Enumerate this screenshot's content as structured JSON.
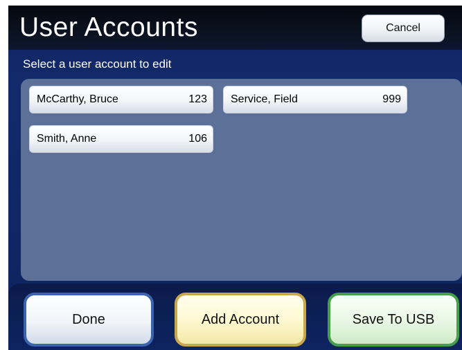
{
  "header": {
    "title": "User Accounts",
    "cancel_label": "Cancel"
  },
  "subtitle": "Select a user account to edit",
  "accounts": [
    {
      "name": "McCarthy, Bruce",
      "id": "123"
    },
    {
      "name": "Service, Field",
      "id": "999"
    },
    {
      "name": "Smith, Anne",
      "id": "106"
    }
  ],
  "actions": {
    "done_label": "Done",
    "add_label": "Add Account",
    "save_label": "Save To USB"
  },
  "colors": {
    "background": "#122a6c",
    "header": "#0b1220",
    "panel": "#5c7098",
    "done_border": "#3c64ad",
    "add_border": "#c9a84d",
    "save_border": "#46a048"
  }
}
